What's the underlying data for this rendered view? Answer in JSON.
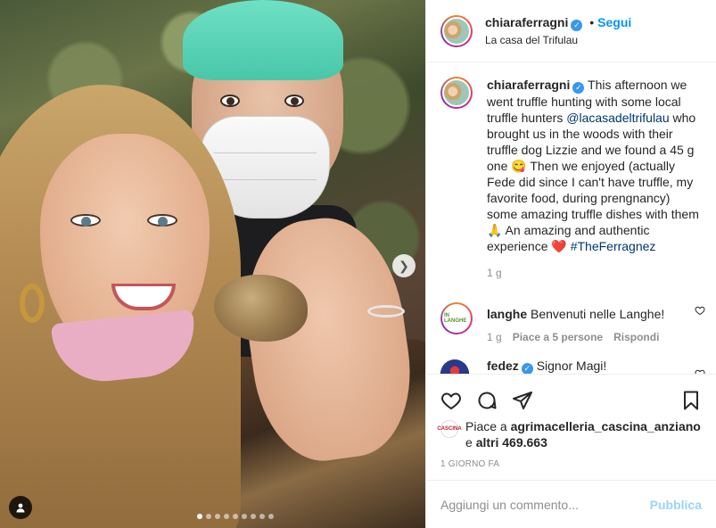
{
  "post": {
    "author": "chiaraferragni",
    "follow_label": "Segui",
    "location": "La casa del Trifulau",
    "follow_separator": "•"
  },
  "caption": {
    "author": "chiaraferragni",
    "text_1": "This afternoon we went truffle hunting with some local truffle hunters",
    "mention": "@lacasadeltrifulau",
    "text_2": "who brought us in the woods with their truffle dog Lizzie and we found a 45 g one 😋 Then we enjoyed (actually Fede did since I can't have truffle, my favorite food, during prengnancy) some amazing truffle dishes with them 🙏 An amazing and authentic experience ❤️",
    "hashtag": "#TheFerragnez",
    "age": "1 g"
  },
  "comments": [
    {
      "author": "langhe",
      "avatar_text": "IN LANGHE",
      "text": "Benvenuti nelle Langhe!",
      "age": "1 g",
      "likes": "Piace a 5 persone",
      "reply": "Rispondi"
    },
    {
      "author": "fedez",
      "text": "Signor Magi!"
    }
  ],
  "likes": {
    "prefix": "Piace a",
    "user": "agrimacelleria_cascina_anziano",
    "middle": "e",
    "others": "altri 469.663",
    "avatar_text": "CASCINA"
  },
  "timestamp": "1 GIORNO FA",
  "comment_box": {
    "placeholder": "Aggiungi un commento...",
    "publish": "Pubblica"
  },
  "carousel": {
    "slides": 9,
    "active": 0
  },
  "colors": {
    "accent": "#0095f6",
    "verified": "#3897f0",
    "heart": "#ed4956"
  }
}
